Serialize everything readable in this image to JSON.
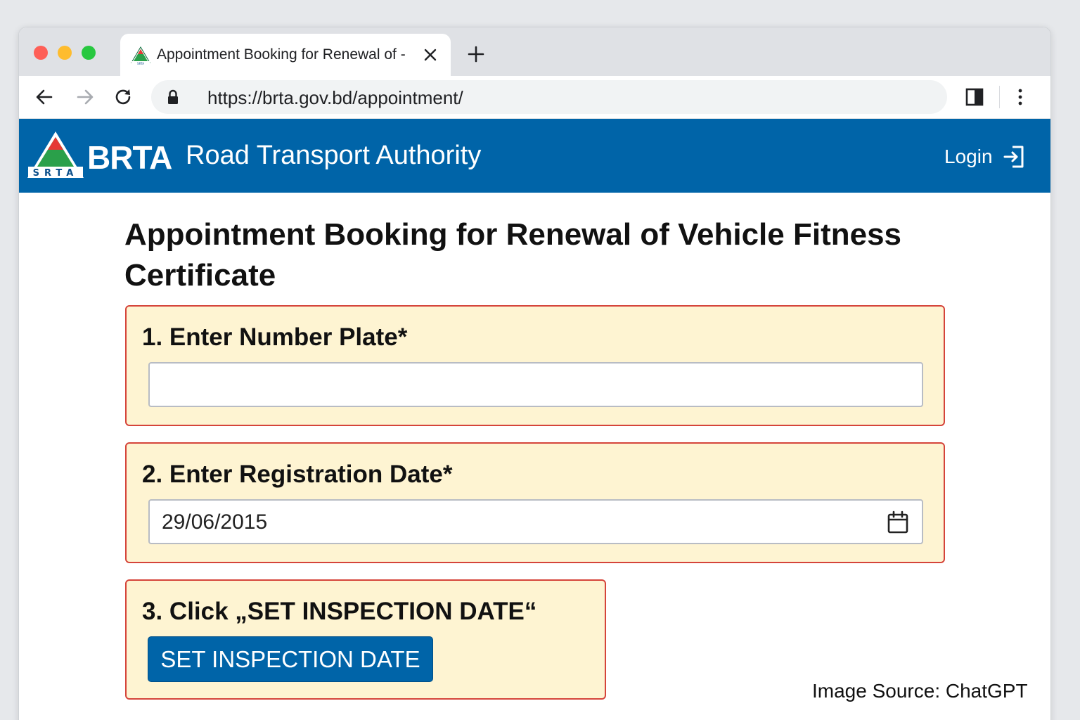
{
  "browser": {
    "tab": {
      "title": "Appointment Booking for Renewal of -",
      "favicon": "brta-logo-icon"
    },
    "url": "https://brta.gov.bd/appointment/",
    "icons": [
      "back-icon",
      "forward-icon",
      "reload-icon",
      "lock-icon",
      "side-panel-icon",
      "menu-icon",
      "close-icon",
      "plus-icon"
    ]
  },
  "header": {
    "logo_letters": "SRTA",
    "brand": "BRTA",
    "subtitle": "Road Transport Authority",
    "login_label": "Login",
    "colors": {
      "header_bg": "#0064a8",
      "text": "#ffffff"
    }
  },
  "main": {
    "title": "Appointment Booking for Renewal of Vehicle Fitness Certificate",
    "steps": [
      {
        "label": "1. Enter Number Plate*",
        "value": "",
        "placeholder": ""
      },
      {
        "label": "2. Enter Registration Date*",
        "value": "29/06/2015"
      },
      {
        "label": "3. Click „SET INSPECTION DATE“",
        "button_label": "SET INSPECTION DATE"
      }
    ],
    "colors": {
      "panel_bg": "#fef4d2",
      "panel_border": "#d5443a",
      "button_bg": "#0064a8"
    }
  },
  "footer_note": "Image Source: ChatGPT"
}
